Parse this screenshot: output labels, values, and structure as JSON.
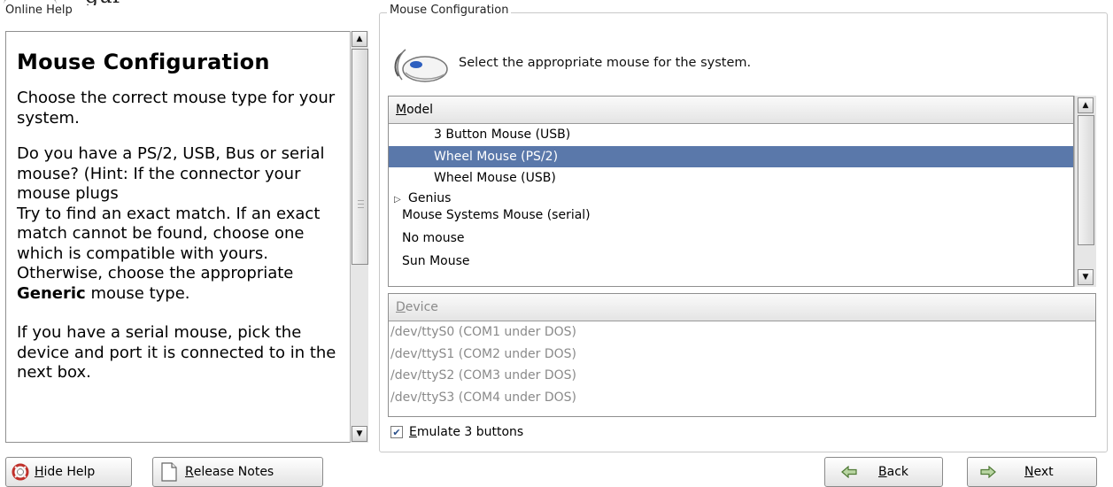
{
  "top_clip_text": "gur",
  "help": {
    "caption": "Online Help",
    "title": "Mouse Configuration",
    "p1": "Choose the correct mouse type for your system.",
    "p2": "Do you have a PS/2, USB, Bus or serial mouse? (Hint: If the connector your mouse plugs",
    "p3_before": "Try to find an exact match. If an exact match cannot be found, choose one which is compatible with yours. Otherwise, choose the appropriate ",
    "p3_bold": "Generic",
    "p3_after": " mouse type.",
    "p4": "If you have a serial mouse, pick the device and port it is connected to in the next box."
  },
  "frame": {
    "legend": "Mouse Configuration",
    "select_text": "Select the appropriate mouse for the system."
  },
  "model": {
    "header_first": "M",
    "header_rest": "odel",
    "rows": [
      {
        "label": "3 Button Mouse (USB)"
      },
      {
        "label": "Wheel Mouse (PS/2)"
      },
      {
        "label": "Wheel Mouse (USB)"
      },
      {
        "label": "Genius"
      },
      {
        "label": "Mouse Systems Mouse (serial)"
      },
      {
        "label": "No mouse"
      },
      {
        "label": "Sun Mouse"
      }
    ],
    "selected_index": 1
  },
  "device": {
    "header_first": "D",
    "header_rest": "evice",
    "rows": [
      {
        "label": "/dev/ttyS0 (COM1 under DOS)"
      },
      {
        "label": "/dev/ttyS1 (COM2 under DOS)"
      },
      {
        "label": "/dev/ttyS2 (COM3 under DOS)"
      },
      {
        "label": "/dev/ttyS3 (COM4 under DOS)"
      }
    ]
  },
  "emulate": {
    "checked": true,
    "label_first": "E",
    "label_rest": "mulate 3 buttons"
  },
  "buttons": {
    "hide_help_first": "H",
    "hide_help_rest": "ide Help",
    "release_notes_first": "R",
    "release_notes_rest": "elease Notes",
    "back_first": "B",
    "back_rest": "ack",
    "next_first": "N",
    "next_rest": "ext"
  },
  "colors": {
    "selection": "#5a78aa",
    "disabled_text": "#8a8a8a",
    "border": "#8f8f8f"
  },
  "icons": {
    "hide_help": "lifebuoy-icon",
    "release_notes": "document-icon",
    "back": "arrow-left-icon",
    "next": "arrow-right-icon",
    "mouse": "mouse-icon",
    "expander": "triangle-right-icon"
  }
}
